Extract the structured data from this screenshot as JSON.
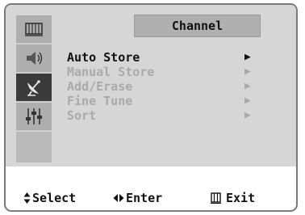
{
  "header": {
    "title": "Channel"
  },
  "sidebar": {
    "items": [
      {
        "icon": "picture-menu-icon",
        "active": false
      },
      {
        "icon": "sound-menu-icon",
        "active": false
      },
      {
        "icon": "satellite-dish-icon",
        "active": true
      },
      {
        "icon": "setup-sliders-icon",
        "active": false
      }
    ]
  },
  "menu": {
    "items": [
      {
        "label": "Auto Store",
        "enabled": true
      },
      {
        "label": "Manual Store",
        "enabled": false
      },
      {
        "label": "Add/Erase",
        "enabled": false
      },
      {
        "label": "Fine Tune",
        "enabled": false
      },
      {
        "label": "Sort",
        "enabled": false
      }
    ],
    "arrow_glyph": "▶"
  },
  "footer": {
    "select_label": "Select",
    "enter_label": "Enter",
    "exit_label": "Exit"
  },
  "colors": {
    "panel": "#d6d6d6",
    "title_bar": "#b0b0b0",
    "sidebar": "#aeaeae",
    "sidebar_active": "#3a3a3a",
    "disabled_text": "#a9a9a9"
  }
}
